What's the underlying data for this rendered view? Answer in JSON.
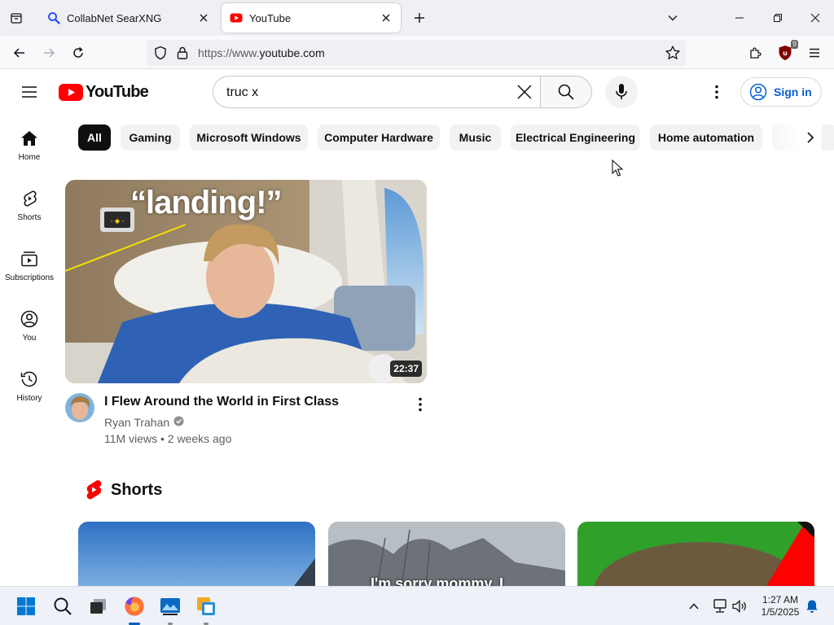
{
  "browser": {
    "tabs": [
      {
        "title": "CollabNet SearXNG",
        "active": false,
        "favicon": "searxng-icon"
      },
      {
        "title": "YouTube",
        "active": true,
        "favicon": "youtube-icon"
      }
    ],
    "url": {
      "scheme_prefix": "https://www.",
      "host": "youtube.com"
    },
    "extension_badge": "9"
  },
  "youtube": {
    "logo_text": "YouTube",
    "search": {
      "query": "truc x"
    },
    "sign_in_label": "Sign in",
    "guide": [
      {
        "label": "Home",
        "icon": "home-icon"
      },
      {
        "label": "Shorts",
        "icon": "shorts-icon"
      },
      {
        "label": "Subscriptions",
        "icon": "subscriptions-icon"
      },
      {
        "label": "You",
        "icon": "you-icon"
      },
      {
        "label": "History",
        "icon": "history-icon"
      }
    ],
    "chips": [
      "All",
      "Gaming",
      "Microsoft Windows",
      "Computer Hardware",
      "Music",
      "Electrical Engineering",
      "Home automation"
    ],
    "selected_chip": "All",
    "video": {
      "thumbnail_caption": "“landing!”",
      "duration": "22:37",
      "title": "I Flew Around the World in First Class",
      "channel": "Ryan Trahan",
      "verified": true,
      "views": "11M views",
      "age": "2 weeks ago",
      "meta": "11M views • 2 weeks ago"
    },
    "shorts_heading": "Shorts",
    "shorts_caption_2": "I'm sorry mommy, I"
  },
  "taskbar": {
    "time": "1:27 AM",
    "date": "1/5/2025"
  },
  "colors": {
    "youtube_red": "#ff0000",
    "link_blue": "#065fd4",
    "chip_bg": "#f2f2f2",
    "chip_selected": "#0f0f0f"
  }
}
